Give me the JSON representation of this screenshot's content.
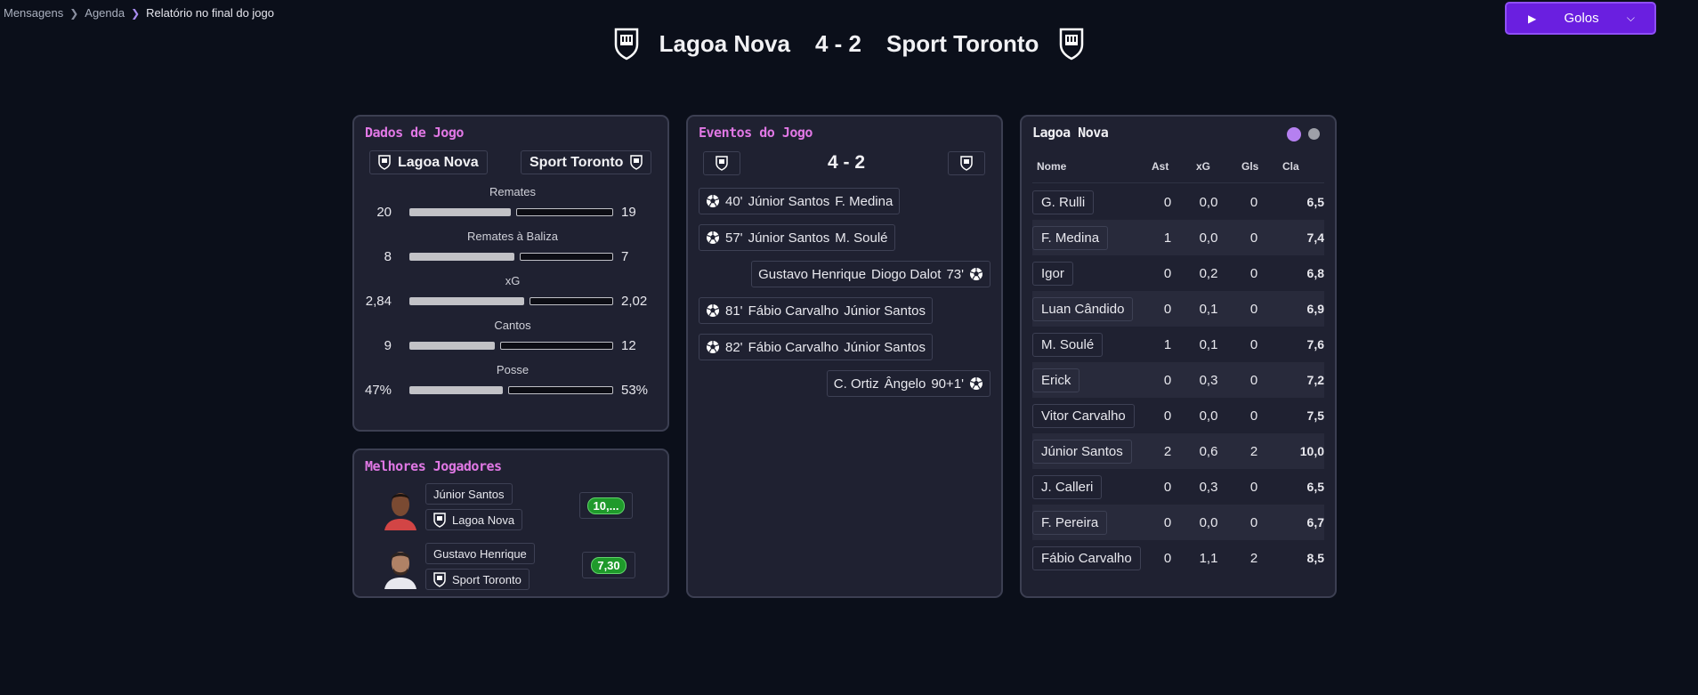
{
  "breadcrumb": {
    "items": [
      "Mensagens",
      "Agenda"
    ],
    "current": "Relatório no final do jogo"
  },
  "action_button": {
    "label": "Golos",
    "icon_left": "play-icon",
    "icon_right": "chevron-down-icon"
  },
  "header": {
    "home_team": "Lagoa Nova",
    "score": "4 - 2",
    "away_team": "Sport Toronto",
    "crest_icon": "shield-crest-icon"
  },
  "dados": {
    "title": "Dados de Jogo",
    "home_team": "Lagoa Nova",
    "away_team": "Sport Toronto",
    "stats": [
      {
        "label": "Remates",
        "home": "20",
        "away": "19",
        "home_share": 0.51
      },
      {
        "label": "Remates à Baliza",
        "home": "8",
        "away": "7",
        "home_share": 0.53
      },
      {
        "label": "xG",
        "home": "2,84",
        "away": "2,02",
        "home_share": 0.58
      },
      {
        "label": "Cantos",
        "home": "9",
        "away": "12",
        "home_share": 0.43
      },
      {
        "label": "Posse",
        "home": "47%",
        "away": "53%",
        "home_share": 0.47
      }
    ]
  },
  "melhores": {
    "title": "Melhores Jogadores",
    "players": [
      {
        "name": "Júnior Santos",
        "team": "Lagoa Nova",
        "rating": "10,..."
      },
      {
        "name": "Gustavo Henrique",
        "team": "Sport Toronto",
        "rating": "7,30"
      }
    ]
  },
  "eventos": {
    "title": "Eventos do Jogo",
    "score": "4 - 2",
    "events": [
      {
        "side": "home",
        "minute": "40'",
        "scorer": "Júnior Santos",
        "assist": "F. Medina"
      },
      {
        "side": "home",
        "minute": "57'",
        "scorer": "Júnior Santos",
        "assist": "M. Soulé"
      },
      {
        "side": "away",
        "minute": "73'",
        "scorer": "Diogo Dalot",
        "assist": "Gustavo Henrique"
      },
      {
        "side": "home",
        "minute": "81'",
        "scorer": "Fábio Carvalho",
        "assist": "Júnior Santos"
      },
      {
        "side": "home",
        "minute": "82'",
        "scorer": "Fábio Carvalho",
        "assist": "Júnior Santos"
      },
      {
        "side": "away",
        "minute": "90+1'",
        "scorer": "Ângelo",
        "assist": "C. Ortiz"
      }
    ]
  },
  "tabela": {
    "title": "Lagoa Nova",
    "dot_colors": [
      "#b580f0",
      "#9ea0a8"
    ],
    "columns": [
      "Nome",
      "Ast",
      "xG",
      "Gls",
      "Cla"
    ],
    "rows": [
      {
        "name": "G. Rulli",
        "ast": "0",
        "xg": "0,0",
        "gls": "0",
        "cla": "6,5"
      },
      {
        "name": "F. Medina",
        "ast": "1",
        "xg": "0,0",
        "gls": "0",
        "cla": "7,4"
      },
      {
        "name": "Igor",
        "ast": "0",
        "xg": "0,2",
        "gls": "0",
        "cla": "6,8"
      },
      {
        "name": "Luan Cândido",
        "ast": "0",
        "xg": "0,1",
        "gls": "0",
        "cla": "6,9"
      },
      {
        "name": "M. Soulé",
        "ast": "1",
        "xg": "0,1",
        "gls": "0",
        "cla": "7,6"
      },
      {
        "name": "Erick",
        "ast": "0",
        "xg": "0,3",
        "gls": "0",
        "cla": "7,2"
      },
      {
        "name": "Vitor Carvalho",
        "ast": "0",
        "xg": "0,0",
        "gls": "0",
        "cla": "7,5"
      },
      {
        "name": "Júnior Santos",
        "ast": "2",
        "xg": "0,6",
        "gls": "2",
        "cla": "10,0"
      },
      {
        "name": "J. Calleri",
        "ast": "0",
        "xg": "0,3",
        "gls": "0",
        "cla": "6,5"
      },
      {
        "name": "F. Pereira",
        "ast": "0",
        "xg": "0,0",
        "gls": "0",
        "cla": "6,7"
      },
      {
        "name": "Fábio Carvalho",
        "ast": "0",
        "xg": "1,1",
        "gls": "2",
        "cla": "8,5"
      }
    ]
  }
}
